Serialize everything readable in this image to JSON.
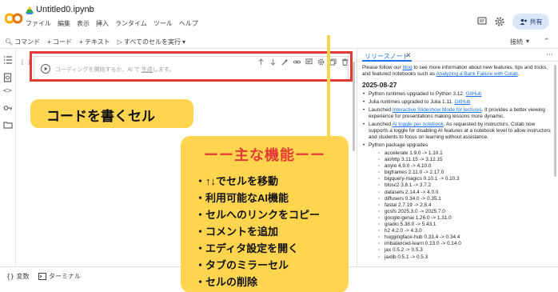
{
  "header": {
    "title": "Untitled0.ipynb",
    "menu": [
      "ファイル",
      "編集",
      "表示",
      "挿入",
      "ランタイム",
      "ツール",
      "ヘルプ"
    ],
    "share_label": "共有"
  },
  "toolbar": {
    "items": [
      "コマンド",
      "+ コード",
      "+ テキスト",
      "すべてのセルを実行"
    ],
    "connect_label": "接続"
  },
  "cell": {
    "bracket": "[ ]",
    "placeholder_pre": "コーディングを開始するか、AI で",
    "placeholder_link": "生成",
    "placeholder_post": "します。"
  },
  "callouts": {
    "code_cell": "コードを書くセル",
    "features_title": "ーー主な機能ーー",
    "features": [
      "・↑↓でセルを移動",
      "・利用可能なAI機能",
      "・セルへのリンクをコピー",
      "・コメントを追加",
      "・エディタ設定を開く",
      "・タブのミラーセル",
      "・セルの削除"
    ]
  },
  "panel": {
    "tab_label": "リリースノート",
    "intro_pre": "Please follow our ",
    "intro_link1": "blog",
    "intro_mid": " to see more information about new features, tips and tricks, and featured notebooks such as ",
    "intro_link2": "Analyzing a Bank Failure with Colab",
    "intro_post": ".",
    "date": "2025-08-27",
    "b1_pre": "Python runtimes upgraded to Python 3.12. ",
    "b1_link": "GitHub",
    "b2_pre": "Julia runtimes upgraded to Julia 1.11. ",
    "b2_link": "GitHub",
    "b3_pre": "Launched ",
    "b3_link": "Interactive Slideshow Mode for lectures",
    "b3_post": ". It provides a better viewing experience for presentations making lessons more dynamic.",
    "b4_pre": "Launched ",
    "b4_link": "AI toggle per notebook",
    "b4_post": ". As requested by instructors, Colab now supports a toggle for disabling AI features at a notebook level to allow instructors and students to focus on learning without assistance.",
    "b5": "Python package upgrades",
    "packages": [
      "accelerate 1.9.0 -> 1.10.1",
      "aiohttp 3.11.15 -> 3.12.15",
      "anyio 4.9.0 -> 4.10.0",
      "bigframes 2.11.0 -> 2.17.0",
      "bigquery-magics 0.10.1 -> 0.10.3",
      "blosc2 3.6.1 -> 3.7.2",
      "datasets 2.14.4 -> 4.0.0",
      "diffusers 0.34.0 -> 0.35.1",
      "fastai 2.7.19 -> 2.8.4",
      "gcsfs 2025.3.0 -> 2025.7.0",
      "google-genai 1.26.0 -> 1.31.0",
      "gradio 5.38.0 -> 5.43.1",
      "h2 4.2.0 -> 4.3.0",
      "huggingface-hub 0.33.4 -> 0.34.4",
      "imbalanced-learn 0.13.0 -> 0.14.0",
      "jax 0.5.2 -> 0.5.3",
      "jaxlib 0.5.1 -> 0.5.3"
    ]
  },
  "bottombar": {
    "variables": "変数",
    "terminal": "ターミナル"
  },
  "colors": {
    "accent": "#1a73e8",
    "highlight": "#ffd54f",
    "alert": "#e53935"
  }
}
